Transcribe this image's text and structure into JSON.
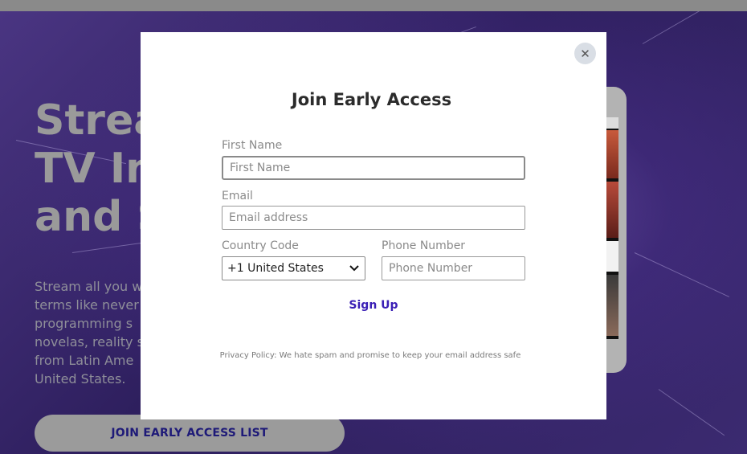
{
  "background": {
    "hero_title_lines": [
      "Strea",
      "TV In",
      "and S"
    ],
    "hero_description_lines": [
      "Stream all you w",
      "terms like never",
      "programming s",
      "novelas, reality s",
      "from Latin Ame",
      "United States."
    ],
    "cta_label": "JOIN EARLY ACCESS LIST"
  },
  "modal": {
    "close_glyph": "✕",
    "title": "Join Early Access",
    "first_name": {
      "label": "First Name",
      "placeholder": "First Name",
      "value": ""
    },
    "email": {
      "label": "Email",
      "placeholder": "Email address",
      "value": ""
    },
    "country_code": {
      "label": "Country Code",
      "selected": "+1 United States"
    },
    "phone": {
      "label": "Phone Number",
      "placeholder": "Phone Number",
      "value": ""
    },
    "submit_label": "Sign Up",
    "privacy_text": "Privacy Policy: We hate spam and promise to keep your email address safe"
  },
  "colors": {
    "accent": "#3a1fb5",
    "hero_bg": "#3a2a66",
    "close_bg": "#d9dee5"
  }
}
